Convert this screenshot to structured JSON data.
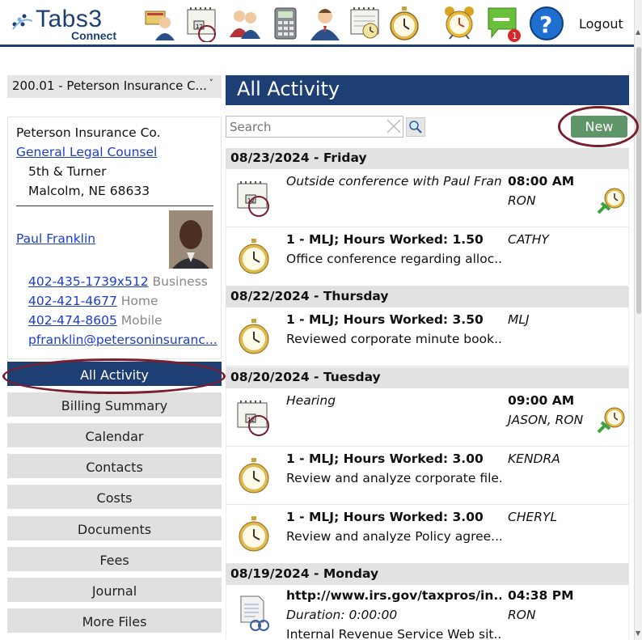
{
  "app": {
    "logo_name": "Tabs3",
    "logo_sub": "Connect",
    "logout_label": "Logout",
    "notification_count": "1"
  },
  "top_icons": [
    "client-icon",
    "calendar-icon",
    "contacts-icon",
    "calculator-icon",
    "user-icon",
    "schedule-icon",
    "stopwatch-icon",
    "alarm-clock-icon",
    "messages-icon",
    "help-icon"
  ],
  "matter": {
    "selected": "200.01 - Peterson Insurance C..."
  },
  "contact": {
    "company": "Peterson Insurance Co.",
    "matter_desc": "General Legal Counsel",
    "address1": "5th & Turner",
    "address2": "Malcolm, NE 68633",
    "person": "Paul Franklin",
    "phones": [
      {
        "number": "402-435-1739x512",
        "type": "Business"
      },
      {
        "number": "402-421-4677",
        "type": "Home"
      },
      {
        "number": "402-474-8605",
        "type": "Mobile"
      }
    ],
    "email": "pfranklin@petersoninsuranc..."
  },
  "nav": {
    "items": [
      {
        "label": "All Activity",
        "active": true
      },
      {
        "label": "Billing Summary"
      },
      {
        "label": "Calendar"
      },
      {
        "label": "Contacts"
      },
      {
        "label": "Costs"
      },
      {
        "label": "Documents"
      },
      {
        "label": "Fees"
      },
      {
        "label": "Journal"
      },
      {
        "label": "More Files"
      }
    ]
  },
  "panel": {
    "title": "All Activity",
    "search_placeholder": "Search",
    "new_label": "New"
  },
  "days": [
    {
      "header": "08/23/2024 - Friday"
    },
    {
      "header": "08/22/2024 - Thursday"
    },
    {
      "header": "08/20/2024 - Tuesday"
    },
    {
      "header": "08/19/2024 - Monday"
    }
  ],
  "entries": [
    {
      "type": "appointment",
      "l1": "Outside conference with Paul Frank...",
      "time": "08:00 AM",
      "who": "RON"
    },
    {
      "type": "fee",
      "l1": "1 - MLJ;  Hours Worked:  1.50",
      "l2": "Office conference regarding alloc...",
      "who": "CATHY"
    },
    {
      "type": "fee",
      "l1": "1 - MLJ;  Hours Worked:  3.50",
      "l2": "Reviewed corporate minute book...",
      "who": "MLJ"
    },
    {
      "type": "appointment",
      "l1": "Hearing",
      "time": "09:00 AM",
      "who": "JASON, RON"
    },
    {
      "type": "fee",
      "l1": "1 - MLJ;  Hours Worked:  3.00",
      "l2": "Review and analyze corporate file...",
      "who": "KENDRA"
    },
    {
      "type": "fee",
      "l1": "1 - MLJ;  Hours Worked:  3.00",
      "l2": "Review and analyze Policy agree...",
      "who": "CHERYL"
    },
    {
      "type": "journal",
      "l1": "http://www.irs.gov/taxpros/in...",
      "l2": "Duration:  0:00:00",
      "l3": "Internal Revenue Service Web sit...",
      "time": "04:38 PM",
      "who": "RON"
    }
  ],
  "colors": {
    "brand_navy": "#1d3f73",
    "new_button": "#5f9667",
    "highlight_ellipse": "#7a1e2e",
    "link": "#1a3dcc"
  }
}
